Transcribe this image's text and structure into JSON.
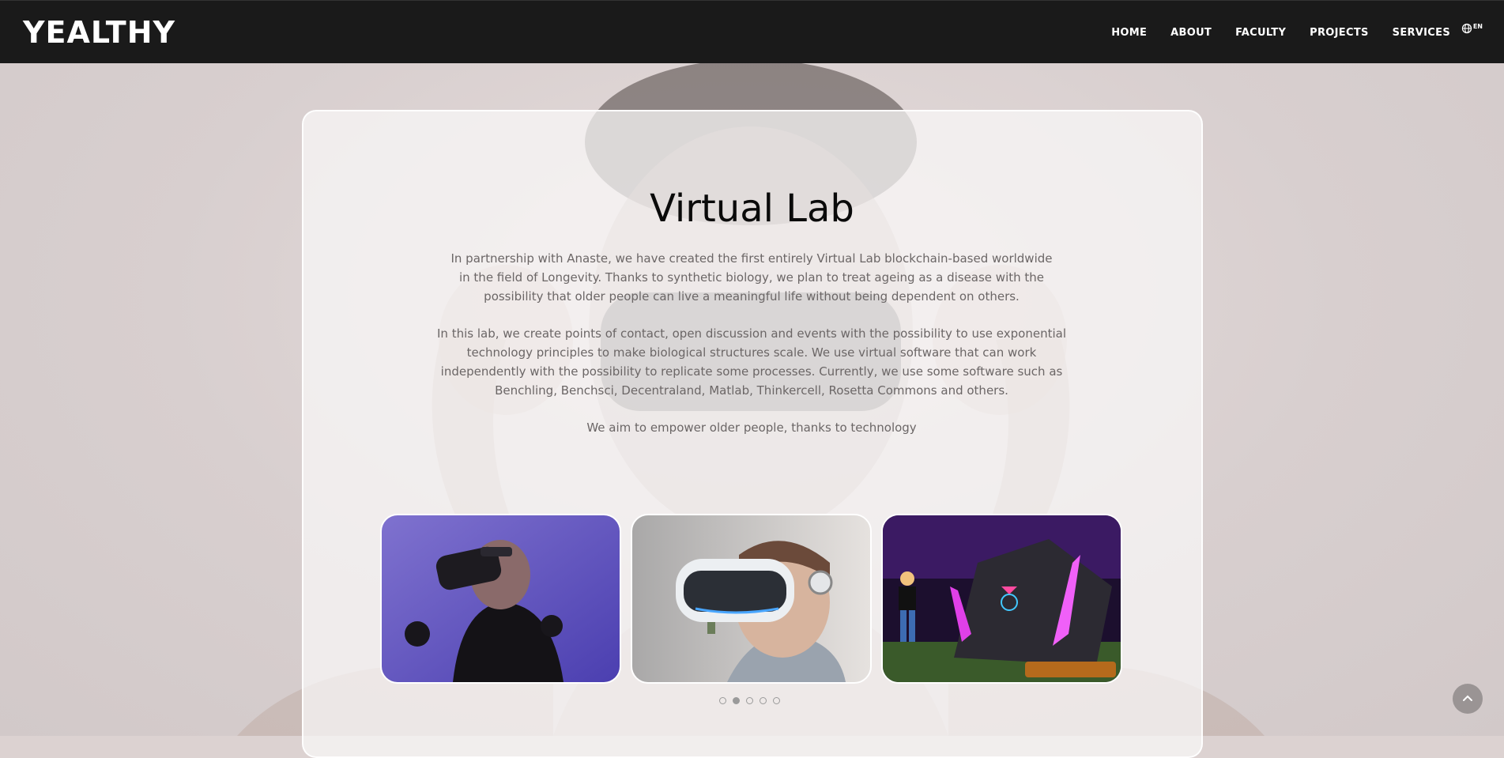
{
  "brand": {
    "logo_text": "YEALTHY"
  },
  "nav": {
    "items": [
      {
        "label": "HOME"
      },
      {
        "label": "ABOUT"
      },
      {
        "label": "FACULTY"
      },
      {
        "label": "PROJECTS"
      },
      {
        "label": "SERVICES"
      }
    ],
    "language": {
      "icon": "globe-icon",
      "label": "EN"
    }
  },
  "main": {
    "title": "Virtual Lab",
    "paragraphs": [
      "In partnership with Anaste, we have created the first entirely Virtual Lab blockchain-based worldwide in the field of Longevity. Thanks to synthetic biology, we plan to treat ageing as a disease with the possibility that older people can live a meaningful life without being dependent on others.",
      "In this lab, we create points of contact, open discussion and events with the possibility to use exponential technology principles to make biological structures scale. We use virtual software that can work independently with the possibility to replicate some processes. Currently, we use some software such as Benchling, Benchsci, Decentraland, Matlab, Thinkercell, Rosetta Commons and others.",
      "We aim to empower older people, thanks to technology"
    ],
    "gallery": {
      "images": [
        {
          "name": "man-vr-headset-purple-image"
        },
        {
          "name": "child-vr-headset-image"
        },
        {
          "name": "decentraland-virtual-world-image"
        }
      ],
      "dots_count": 5,
      "active_dot": 2
    }
  },
  "scroll_top": {
    "icon": "chevron-up-icon"
  },
  "colors": {
    "header_bg": "#1a1a1a",
    "title": "#0a0a0a",
    "body_text": "#6b6666",
    "accent_purple": "#6a5bd6"
  }
}
